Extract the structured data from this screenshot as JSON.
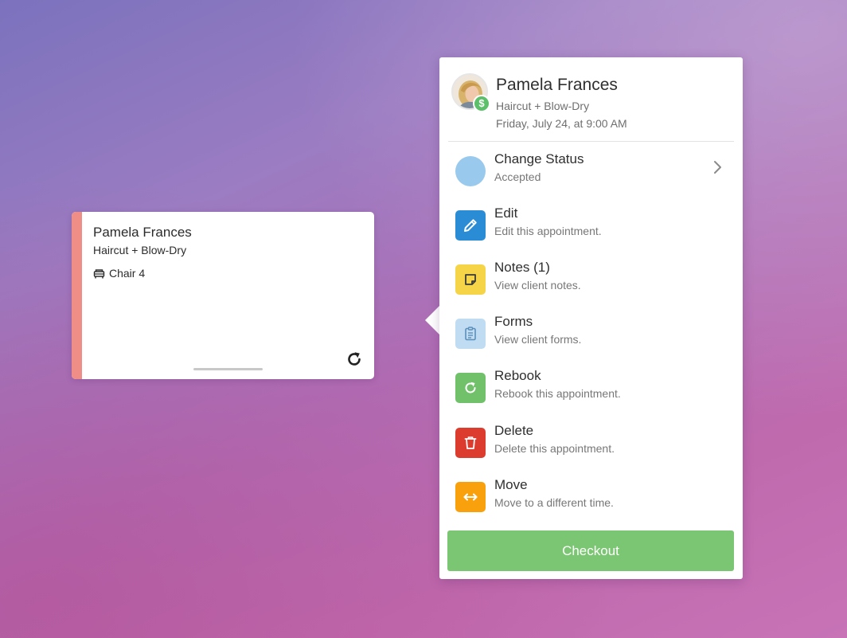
{
  "appointment_card": {
    "client_name": "Pamela Frances",
    "service": "Haircut + Blow-Dry",
    "chair": "Chair 4",
    "stripe_color": "#ef8e86",
    "rebook_icon": "rebook-icon"
  },
  "popover": {
    "client_name": "Pamela Frances",
    "service": "Haircut + Blow-Dry",
    "datetime": "Friday, July 24, at 9:00 AM",
    "avatar_badge": "$",
    "menu": [
      {
        "title": "Change Status",
        "subtitle": "Accepted",
        "icon": "status-dot-icon",
        "color": "#99c9ec"
      },
      {
        "title": "Edit",
        "subtitle": "Edit this appointment.",
        "icon": "pencil-icon",
        "color": "#2b8cd6"
      },
      {
        "title": "Notes (1)",
        "subtitle": "View client notes.",
        "icon": "note-icon",
        "color": "#f5d547"
      },
      {
        "title": "Forms",
        "subtitle": "View client forms.",
        "icon": "clipboard-icon",
        "color": "#bfdcf3"
      },
      {
        "title": "Rebook",
        "subtitle": "Rebook this appointment.",
        "icon": "rebook-icon",
        "color": "#70c16a"
      },
      {
        "title": "Delete",
        "subtitle": "Delete this appointment.",
        "icon": "trash-icon",
        "color": "#dc3c2e"
      },
      {
        "title": "Move",
        "subtitle": "Move to a different time.",
        "icon": "arrows-horizontal-icon",
        "color": "#f9a10c"
      }
    ],
    "checkout_label": "Checkout",
    "checkout_color": "#7bc672"
  }
}
